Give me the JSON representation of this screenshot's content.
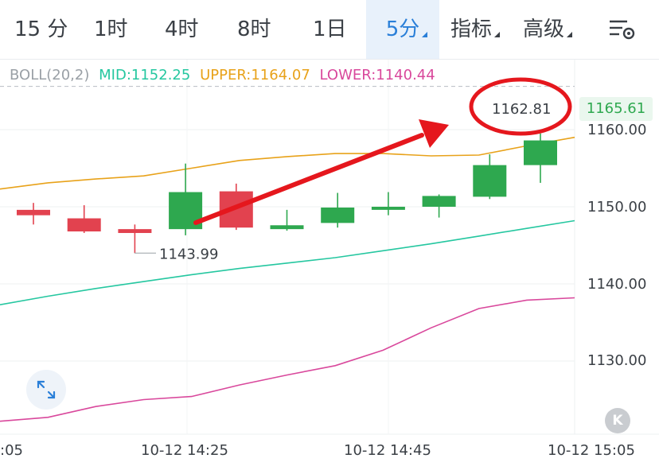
{
  "toolbar": {
    "tabs": [
      {
        "label": "15 分"
      },
      {
        "label": "1时"
      },
      {
        "label": "4时"
      },
      {
        "label": "8时"
      },
      {
        "label": "1日"
      },
      {
        "label": "5分"
      },
      {
        "label": "指标"
      },
      {
        "label": "高级"
      }
    ],
    "active_tab": "5分",
    "settings_icon": "chart-settings-icon"
  },
  "indicator": {
    "name": "BOLL(20,2)",
    "mid_label": "MID:",
    "mid_value": "1152.25",
    "upper_label": "UPPER:",
    "upper_value": "1164.07",
    "lower_label": "LOWER:",
    "lower_value": "1140.44"
  },
  "current_price": "1165.61",
  "annotation": {
    "circled_price": "1162.81",
    "low_label": "1143.99"
  },
  "y_axis": [
    "1160.00",
    "1150.00",
    "1140.00",
    "1130.00"
  ],
  "x_axis": [
    ":05",
    "10-12 14:25",
    "10-12 14:45",
    "10-12 15:05"
  ],
  "controls": {
    "fullscreen_icon": "expand-icon",
    "collapse_label": "K"
  },
  "colors": {
    "up": "#2ea84f",
    "down": "#e2424f",
    "upper": "#e8a21a",
    "mid": "#25c7a0",
    "lower": "#d9489c",
    "annotation": "#e5171d",
    "accent": "#2a7fd8"
  },
  "chart_data": {
    "type": "candlestick",
    "ylim": [
      1122,
      1170
    ],
    "candles": [
      {
        "open": 1149.6,
        "high": 1150.5,
        "low": 1147.7,
        "close": 1148.9,
        "dir": "down"
      },
      {
        "open": 1148.5,
        "high": 1150.2,
        "low": 1146.6,
        "close": 1146.8,
        "dir": "down"
      },
      {
        "open": 1147.1,
        "high": 1147.7,
        "low": 1143.99,
        "close": 1146.6,
        "dir": "down"
      },
      {
        "open": 1147.1,
        "high": 1155.6,
        "low": 1146.3,
        "close": 1151.9,
        "dir": "up"
      },
      {
        "open": 1152.0,
        "high": 1153.0,
        "low": 1147.0,
        "close": 1147.3,
        "dir": "down"
      },
      {
        "open": 1147.1,
        "high": 1149.6,
        "low": 1146.9,
        "close": 1147.6,
        "dir": "up"
      },
      {
        "open": 1147.9,
        "high": 1151.8,
        "low": 1147.3,
        "close": 1149.9,
        "dir": "up"
      },
      {
        "open": 1149.6,
        "high": 1151.9,
        "low": 1148.9,
        "close": 1150.0,
        "dir": "up"
      },
      {
        "open": 1150.0,
        "high": 1151.6,
        "low": 1148.6,
        "close": 1151.4,
        "dir": "up"
      },
      {
        "open": 1151.3,
        "high": 1156.8,
        "low": 1151.0,
        "close": 1155.4,
        "dir": "up"
      },
      {
        "open": 1155.4,
        "high": 1159.5,
        "low": 1153.1,
        "close": 1158.6,
        "dir": "up"
      }
    ],
    "upper": [
      1152.3,
      1153.1,
      1153.6,
      1154.0,
      1155.0,
      1156.0,
      1156.5,
      1156.9,
      1156.9,
      1156.6,
      1156.7,
      1157.9,
      1159.0
    ],
    "mid": [
      1137.3,
      1138.4,
      1139.4,
      1140.3,
      1141.2,
      1142.0,
      1142.7,
      1143.4,
      1144.3,
      1145.2,
      1146.2,
      1147.2,
      1148.2
    ],
    "lower": [
      1122.2,
      1122.7,
      1124.1,
      1125.0,
      1125.4,
      1126.9,
      1128.2,
      1129.4,
      1131.4,
      1134.3,
      1136.8,
      1137.9,
      1138.2
    ],
    "last_price": 1165.61
  }
}
